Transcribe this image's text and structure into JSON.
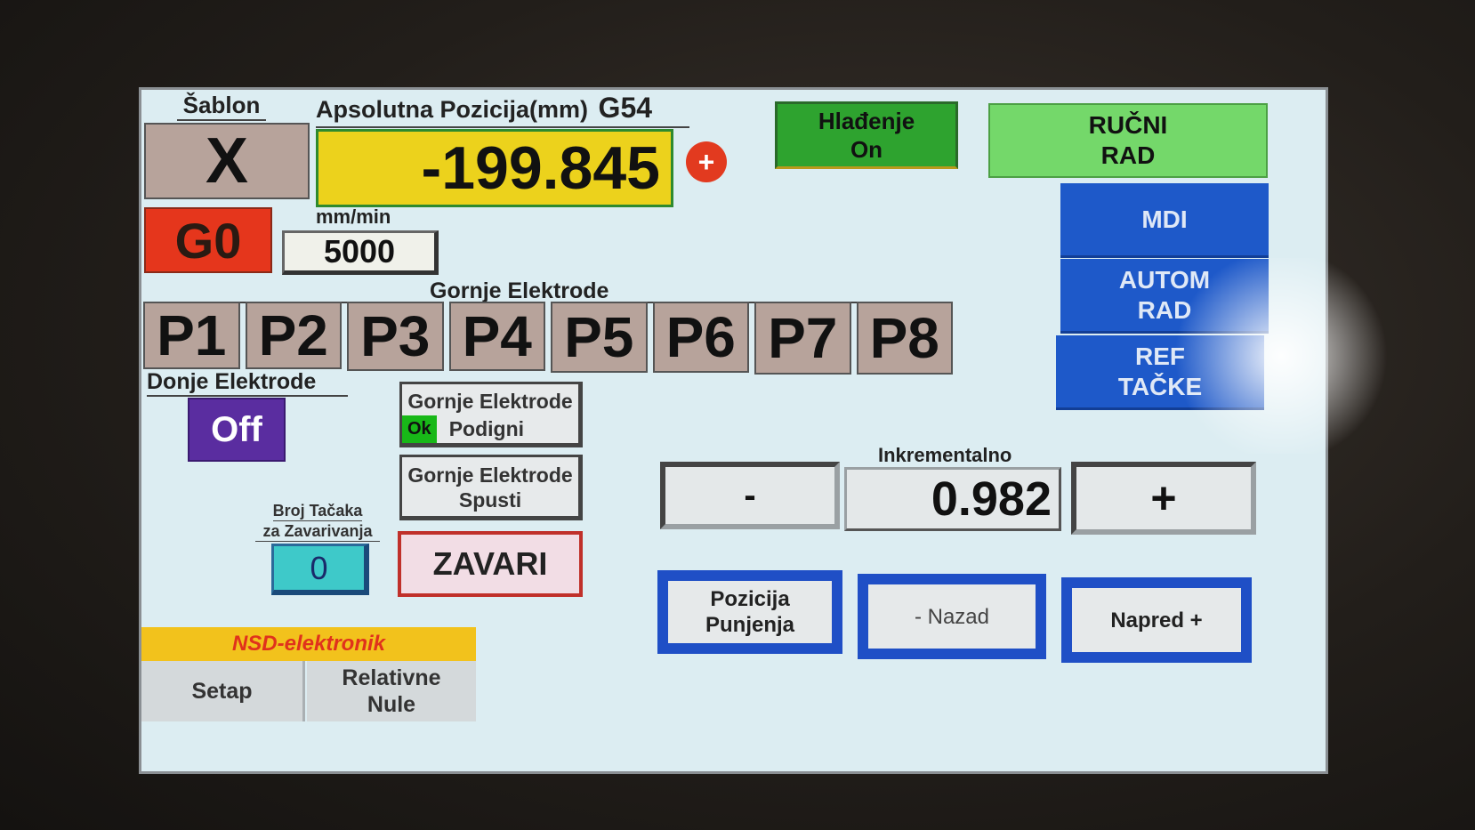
{
  "header": {
    "template_label": "Šablon",
    "axis": "X",
    "position_label": "Apsolutna Pozicija(mm)",
    "coord_system": "G54",
    "position_value": "-199.845",
    "plus_icon": "+"
  },
  "motion": {
    "gcode": "G0",
    "feed_unit": "mm/min",
    "feed_value": "5000"
  },
  "cooling": {
    "line1": "Hlađenje",
    "line2": "On"
  },
  "modes": {
    "manual_line1": "RUČNI",
    "manual_line2": "RAD",
    "mdi": "MDI",
    "auto_line1": "AUTOM",
    "auto_line2": "RAD",
    "points_line1": "REF",
    "points_line2": "TAČKE"
  },
  "upper_electrodes": {
    "title": "Gornje Elektrode",
    "buttons": [
      "P1",
      "P2",
      "P3",
      "P4",
      "P5",
      "P6",
      "P7",
      "P8"
    ]
  },
  "lower_electrodes": {
    "title": "Donje Elektrode",
    "state": "Off"
  },
  "electrode_actions": {
    "raise_title": "Gornje Elektrode",
    "raise_status": "Ok",
    "raise_label": "Podigni",
    "lower_title": "Gornje Elektrode",
    "lower_label": "Spusti",
    "weld": "ZAVARI"
  },
  "weld_points": {
    "label_line1": "Broj Tačaka",
    "label_line2": "za Zavarivanja",
    "value": "0"
  },
  "jog": {
    "minus": "-",
    "increment_label": "Inkrementalno",
    "increment_value": "0.982",
    "plus": "+"
  },
  "nav": {
    "load_line1": "Pozicija",
    "load_line2": "Punjenja",
    "back": "- Nazad",
    "forward": "Napred +"
  },
  "footer": {
    "brand": "NSD-elektronik",
    "setup": "Setap",
    "rel_line1": "Relativne",
    "rel_line2": "Nule"
  },
  "colors": {
    "screen_bg": "#dcedf2",
    "position_bg": "#ecd21c",
    "gcode_bg": "#e5361c",
    "cooling_bg": "#2ea32f",
    "manual_bg": "#74d86a",
    "mode_blue": "#1e59c9",
    "off_purple": "#5a2da0",
    "weld_points_bg": "#3ec9c9",
    "brand_bar": "#f2c21c"
  }
}
